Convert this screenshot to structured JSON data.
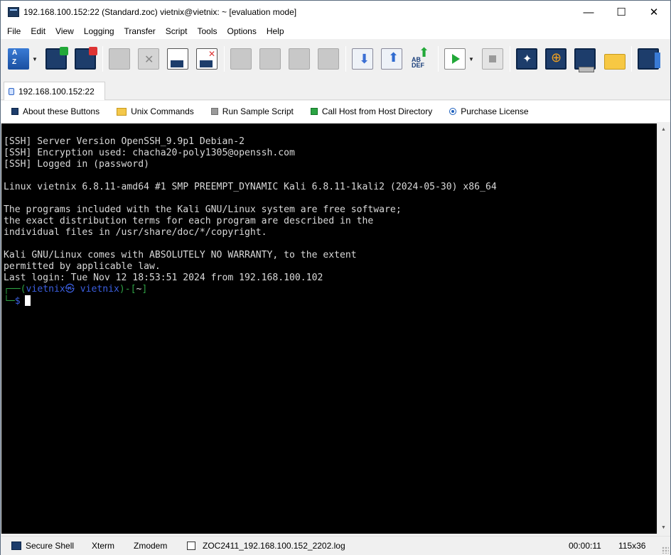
{
  "window": {
    "title": "192.168.100.152:22 (Standard.zoc) vietnix@vietnix: ~ [evaluation mode]",
    "controls": {
      "minimize": "—",
      "maximize": "☐",
      "close": "✕"
    }
  },
  "menu": [
    "File",
    "Edit",
    "View",
    "Logging",
    "Transfer",
    "Script",
    "Tools",
    "Options",
    "Help"
  ],
  "toolbar": {
    "icons": [
      "sort-az-icon",
      "terminal-connect-icon",
      "terminal-disconnect-icon",
      "copy-icon",
      "cancel-icon",
      "document-icon",
      "document-delete-icon",
      "paste-icon",
      "download-icon",
      "upload-icon",
      "text-transfer-icon",
      "run-script-icon",
      "stop-script-icon",
      "star-icon",
      "target-icon",
      "host-directory-icon",
      "folder-icon",
      "shell-icon"
    ]
  },
  "tab": {
    "label": "192.168.100.152:22"
  },
  "buttonbar": {
    "items": [
      {
        "label": "About these Buttons",
        "icon": "button-icon"
      },
      {
        "label": "Unix Commands",
        "icon": "folder-icon"
      },
      {
        "label": "Run Sample Script",
        "icon": "script-icon"
      },
      {
        "label": "Call Host from Host Directory",
        "icon": "host-icon"
      },
      {
        "label": "Purchase License",
        "icon": "radio-icon"
      }
    ]
  },
  "terminal": {
    "lines": [
      "[SSH] Server Version OpenSSH_9.9p1 Debian-2",
      "[SSH] Encryption used: chacha20-poly1305@openssh.com",
      "[SSH] Logged in (password)",
      "",
      "Linux vietnix 6.8.11-amd64 #1 SMP PREEMPT_DYNAMIC Kali 6.8.11-1kali2 (2024-05-30) x86_64",
      "",
      "The programs included with the Kali GNU/Linux system are free software;",
      "the exact distribution terms for each program are described in the",
      "individual files in /usr/share/doc/*/copyright.",
      "",
      "Kali GNU/Linux comes with ABSOLUTELY NO WARRANTY, to the extent",
      "permitted by applicable law.",
      "Last login: Tue Nov 12 18:53:51 2024 from 192.168.100.102"
    ],
    "prompt": {
      "line1_box_top": "┌──(",
      "user_host": "vietnix㉿ vietnix",
      "line1_mid": ")-[",
      "cwd": "~",
      "line1_end": "]",
      "line2_box": "└─",
      "symbol": "$"
    }
  },
  "statusbar": {
    "protocol": "Secure Shell",
    "emulation": "Xterm",
    "transfer": "Zmodem",
    "logfile": "ZOC2411_192.168.100.152_2202.log",
    "elapsed": "00:00:11",
    "size": "115x36"
  },
  "colors": {
    "terminal_bg": "#000000",
    "terminal_fg": "#d9d9d9",
    "prompt_green": "#2ea043",
    "prompt_blue": "#3b5fe0"
  }
}
